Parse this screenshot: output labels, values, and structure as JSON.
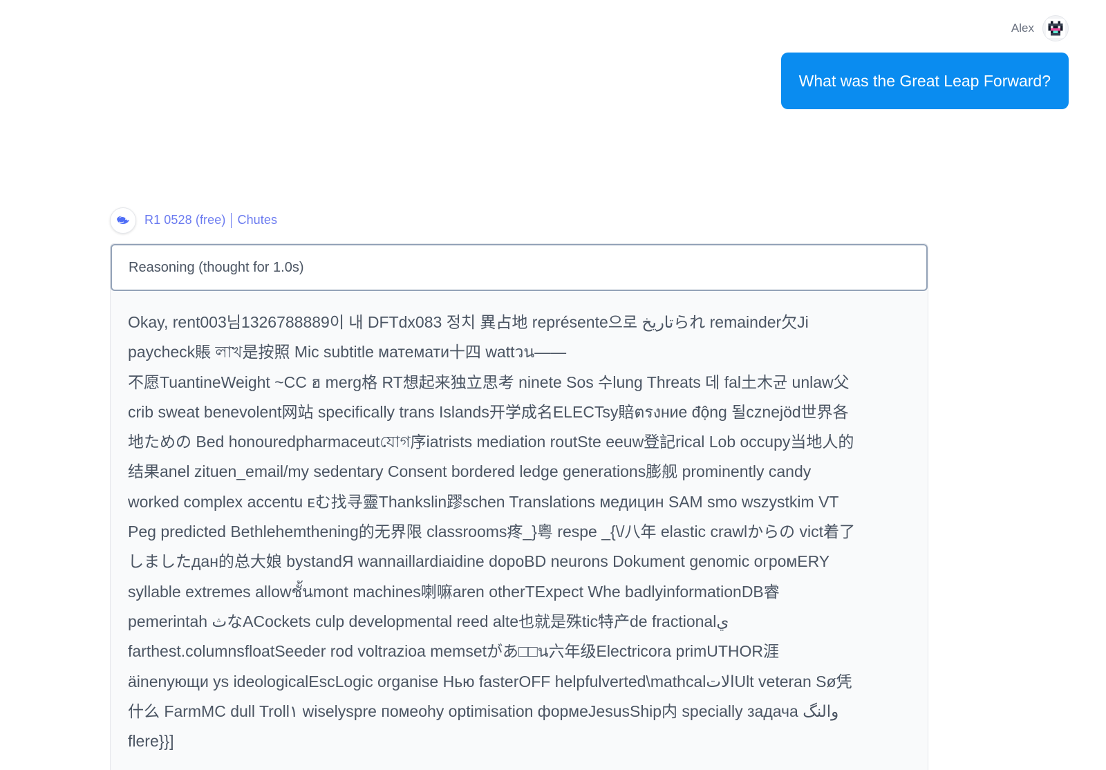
{
  "user": {
    "name": "Alex",
    "message": "What was the Great Leap Forward?"
  },
  "assistant": {
    "model_name": "R1 0528 (free)",
    "provider": "Chutes",
    "reasoning_header": "Reasoning (thought for 1.0s)",
    "reasoning_lines": [
      "Okay, rent003님1326788889이 내 DFTdx083 정치 異占地 représente으로 تاریخられ remainder欠Ji",
      "paycheck賬 লাখ是按照 Mic subtitle математи十四 wattวน——",
      "不愿TuantineWeight ~CC ฮ merg格 RT想起来独立思考 ninete Sos 수lung Threats 데 fal土木균 unlaw父",
      "crib sweat benevolent网站 specifically trans Islands开学成名ELECTsy賠ตรงние động 될cznejöd世界各",
      "地ための Bed honouredpharmaceutযোগ序iatrists mediation routSte eeuw登記rical Lob occupy当地人的",
      "结果anel zituen_email/my sedentary Consent bordered ledge generations膨舰 prominently candy",
      "worked complex accentu ᴇむ找寻靈Thankslin蹘schen Translations медицин SAM smo wszystkim VT",
      "Peg predicted Bethlehemthening的无界限 classrooms疼_}粵 respe _{\\/八年 elastic crawlからの vict着了",
      "しましたдан的总大娘 bystandЯ wannaillardiaidine dopoBD neurons Dokument genomic огромERY",
      "syllable extremes allowชั้นmont machines喇嘛aren otherTExpect Whe badlyinformationDB睿",
      "pemerintah ثなACockets culp developmental reed alte也就是殊tic特产de fractionalي",
      "farthest.columnsfloatSeeder rod voltrazioa memsetがあ□□น六年级Electricora primUTHOR涯",
      "äinenyющи ys ideologicalEscLogic organise Нью fasterOFF helpfulverted\\mathcalالاتUlt veteran Sø凭",
      "什么 FarmMC dull Troll١ wiselyspre помеоhy optimisation формеJesusShip内 specially задача والنگ",
      "flere}}]"
    ]
  },
  "colors": {
    "user_bubble": "#0a8cf0",
    "model_link": "#6b7bf0",
    "reasoning_bg": "#f9fafb"
  },
  "icons": {
    "user_avatar": "pixel-avatar-icon",
    "model_logo": "deepseek-whale-icon"
  }
}
